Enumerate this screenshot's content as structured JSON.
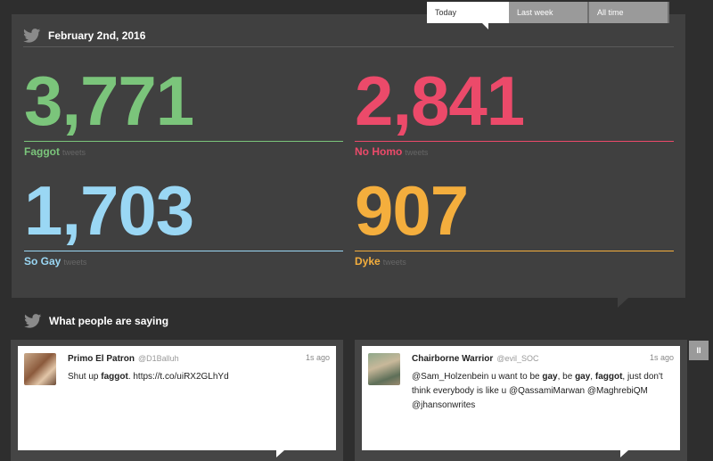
{
  "tabs": [
    {
      "label": "Today",
      "active": true
    },
    {
      "label": "Last week",
      "active": false
    },
    {
      "label": "All time",
      "active": false
    }
  ],
  "header": {
    "title": "February 2nd, 2016",
    "icon": "twitter-bird-icon"
  },
  "stats": [
    {
      "value": "3,771",
      "label": "Faggot",
      "sub": "tweets",
      "color": "#7bc57b"
    },
    {
      "value": "2,841",
      "label": "No Homo",
      "sub": "tweets",
      "color": "#ec4a6a"
    },
    {
      "value": "1,703",
      "label": "So Gay",
      "sub": "tweets",
      "color": "#9ad7f4"
    },
    {
      "value": "907",
      "label": "Dyke",
      "sub": "tweets",
      "color": "#f4ae3d"
    }
  ],
  "section": {
    "title": "What people are saying",
    "icon": "twitter-bird-icon"
  },
  "tweets": [
    {
      "name": "Primo El Patron",
      "handle": "@D1Balluh",
      "time": "1s ago",
      "text_parts": [
        "Shut up ",
        "faggot",
        ". https://t.co/uiRX2GLhYd"
      ]
    },
    {
      "name": "Chairborne Warrior",
      "handle": "@evil_SOC",
      "time": "1s ago",
      "text_parts": [
        "@Sam_Holzenbein u want to be ",
        "gay",
        ", be ",
        "gay",
        ", ",
        "faggot",
        ", just don't think everybody is like u @QassamiMarwan @MaghrebiQM @jhansonwrites"
      ]
    }
  ],
  "controls": {
    "pause_label": "II"
  }
}
